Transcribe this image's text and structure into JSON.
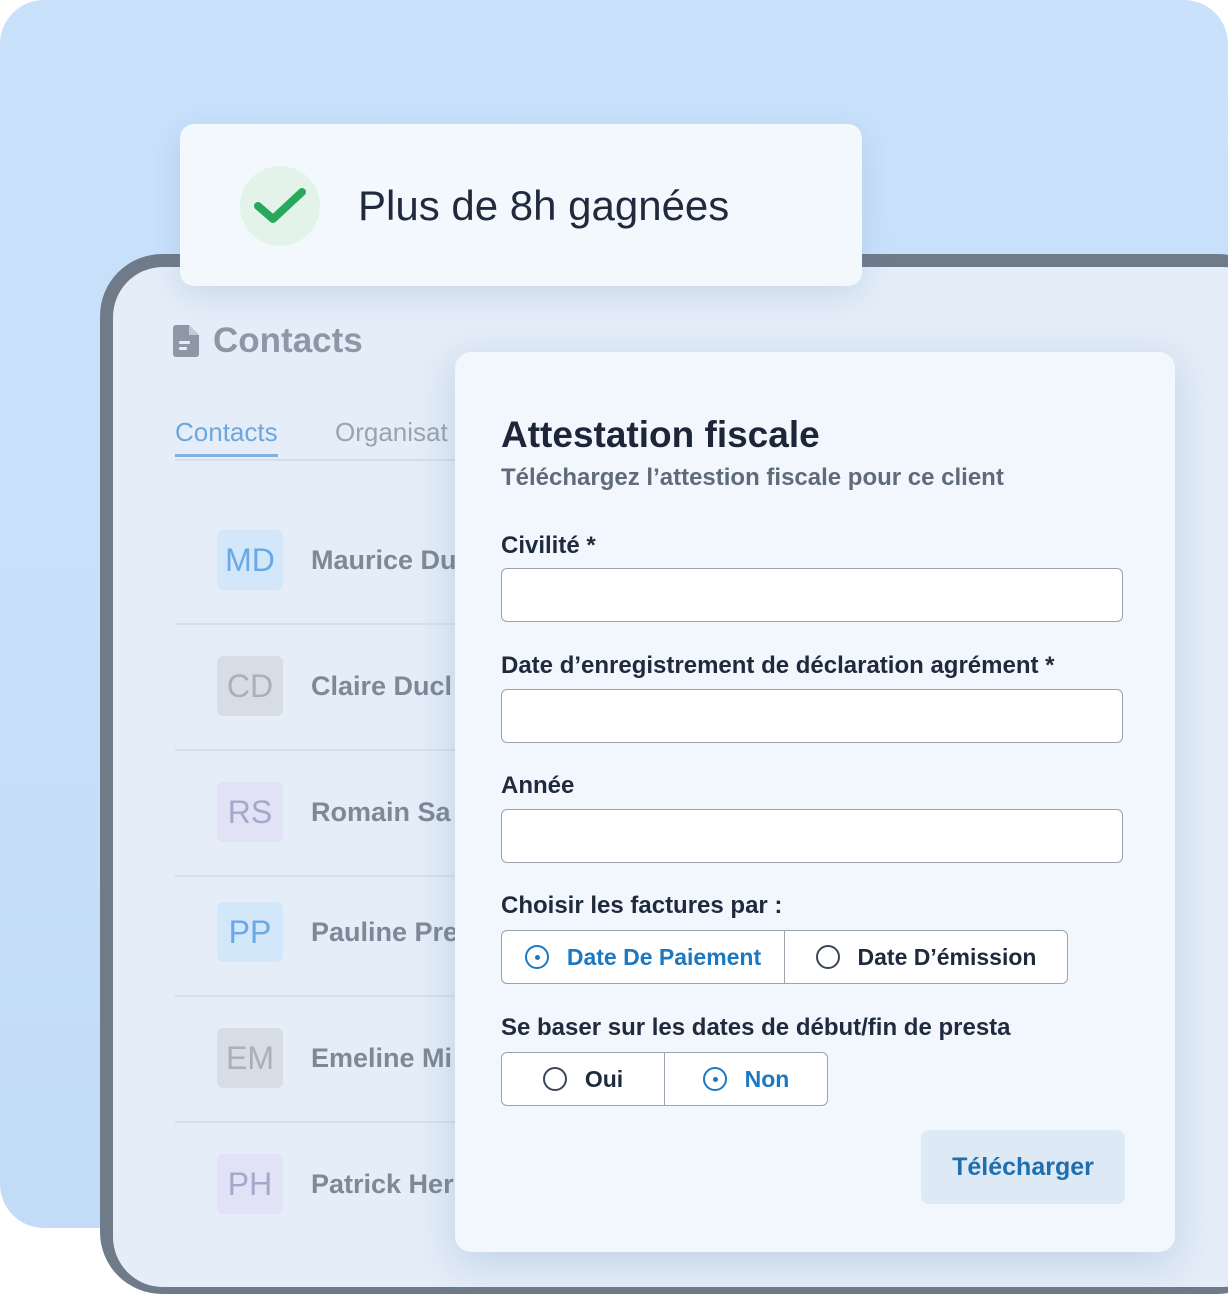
{
  "badge": {
    "text": "Plus de 8h gagnées",
    "icon": "check-icon",
    "accent": "#27a85b"
  },
  "contacts_page": {
    "title": "Contacts",
    "title_icon": "document-icon",
    "tabs": [
      {
        "label": "Contacts",
        "active": true
      },
      {
        "label": "Organisat",
        "active": false
      }
    ],
    "rows": [
      {
        "initials": "MD",
        "name": "Maurice Du",
        "color": "#6aa8e6",
        "bg": "#d3e7fb"
      },
      {
        "initials": "CD",
        "name": "Claire Ducl",
        "color": "#a8b0bb",
        "bg": "#d7dde4"
      },
      {
        "initials": "RS",
        "name": "Romain Sa",
        "color": "#a3a9c9",
        "bg": "#e2e2f6"
      },
      {
        "initials": "PP",
        "name": "Pauline Pre",
        "color": "#6aa8e6",
        "bg": "#d3e7fb"
      },
      {
        "initials": "EM",
        "name": "Emeline Mi",
        "color": "#a8b0bb",
        "bg": "#d7dde4"
      },
      {
        "initials": "PH",
        "name": "Patrick Her",
        "color": "#a3a9c9",
        "bg": "#e2e2f6"
      }
    ]
  },
  "modal": {
    "title": "Attestation fiscale",
    "subtitle": "Téléchargez l’attestion fiscale pour ce client",
    "fields": {
      "civilite": {
        "label": "Civilité *",
        "value": ""
      },
      "date_enregistrement": {
        "label": "Date d’enregistrement de déclaration agrément *",
        "value": ""
      },
      "annee": {
        "label": "Année",
        "value": ""
      }
    },
    "factures": {
      "label": "Choisir les factures par :",
      "options": [
        {
          "label": "Date De Paiement",
          "selected": true
        },
        {
          "label": "Date D’émission",
          "selected": false
        }
      ]
    },
    "presta": {
      "label": "Se baser sur les dates de début/fin de presta",
      "options": [
        {
          "label": "Oui",
          "selected": false
        },
        {
          "label": "Non",
          "selected": true
        }
      ]
    },
    "download_label": "Télécharger"
  }
}
